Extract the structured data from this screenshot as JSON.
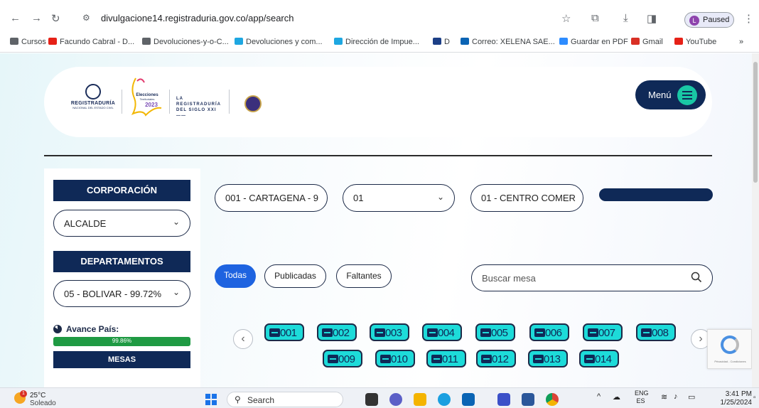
{
  "browser": {
    "url": "divulgacione14.registraduria.gov.co/app/search",
    "profile_status": "Paused",
    "profile_initial": "L",
    "bookmarks": [
      {
        "label": "Cursos",
        "color": "#5f6368"
      },
      {
        "label": "Facundo Cabral - D...",
        "color": "#e62117"
      },
      {
        "label": "Devoluciones-y-o-C...",
        "color": "#5f6368"
      },
      {
        "label": "Devoluciones y com...",
        "color": "#1ea7e1"
      },
      {
        "label": "Dirección de Impue...",
        "color": "#1ea7e1"
      },
      {
        "label": "D",
        "color": "#1c3f86"
      },
      {
        "label": "Correo: XELENA SAE...",
        "color": "#0a64b4"
      },
      {
        "label": "Guardar en PDF",
        "color": "#2d8cff"
      },
      {
        "label": "Gmail",
        "color": "#d93025"
      },
      {
        "label": "YouTube",
        "color": "#e62117"
      }
    ]
  },
  "header": {
    "registraduria_wordmark": "REGISTRADURÍA",
    "registraduria_subtitle": "NACIONAL DEL ESTADO CIVIL",
    "elecciones_text": "Elecciones Territoriales 2023",
    "siglo_text": "LA REGISTRADURÍA DEL SIGLO XXI",
    "menu_label": "Menú"
  },
  "sidebar": {
    "corporacion_heading": "CORPORACIÓN",
    "corporacion_value": "ALCALDE",
    "departamentos_heading": "DEPARTAMENTOS",
    "departamento_value": "05 - BOLIVAR - 99.72%",
    "avance_label": "Avance País:",
    "avance_percent_text": "99.86%",
    "avance_fraction": 0.9986,
    "mesas_heading": "MESAS"
  },
  "filters": {
    "municipio": "001 - CARTAGENA - 9",
    "zona": "01",
    "puesto": "01 - CENTRO COMER"
  },
  "tabs": {
    "todas": "Todas",
    "publicadas": "Publicadas",
    "faltantes": "Faltantes"
  },
  "search": {
    "placeholder": "Buscar mesa"
  },
  "mesas": [
    "001",
    "002",
    "003",
    "004",
    "005",
    "006",
    "007",
    "008",
    "009",
    "010",
    "011",
    "012",
    "013",
    "014"
  ],
  "taskbar": {
    "temp": "25°C",
    "weather": "Soleado",
    "notif_count": "1",
    "search_label": "Search",
    "lang_top": "ENG",
    "lang_bottom": "ES",
    "time": "3:41 PM",
    "date": "1/25/2024"
  },
  "colors": {
    "navy": "#0f2957",
    "accent_teal": "#1ddbd9",
    "tab_active": "#1e63e0",
    "progress_green": "#1f9a43"
  }
}
